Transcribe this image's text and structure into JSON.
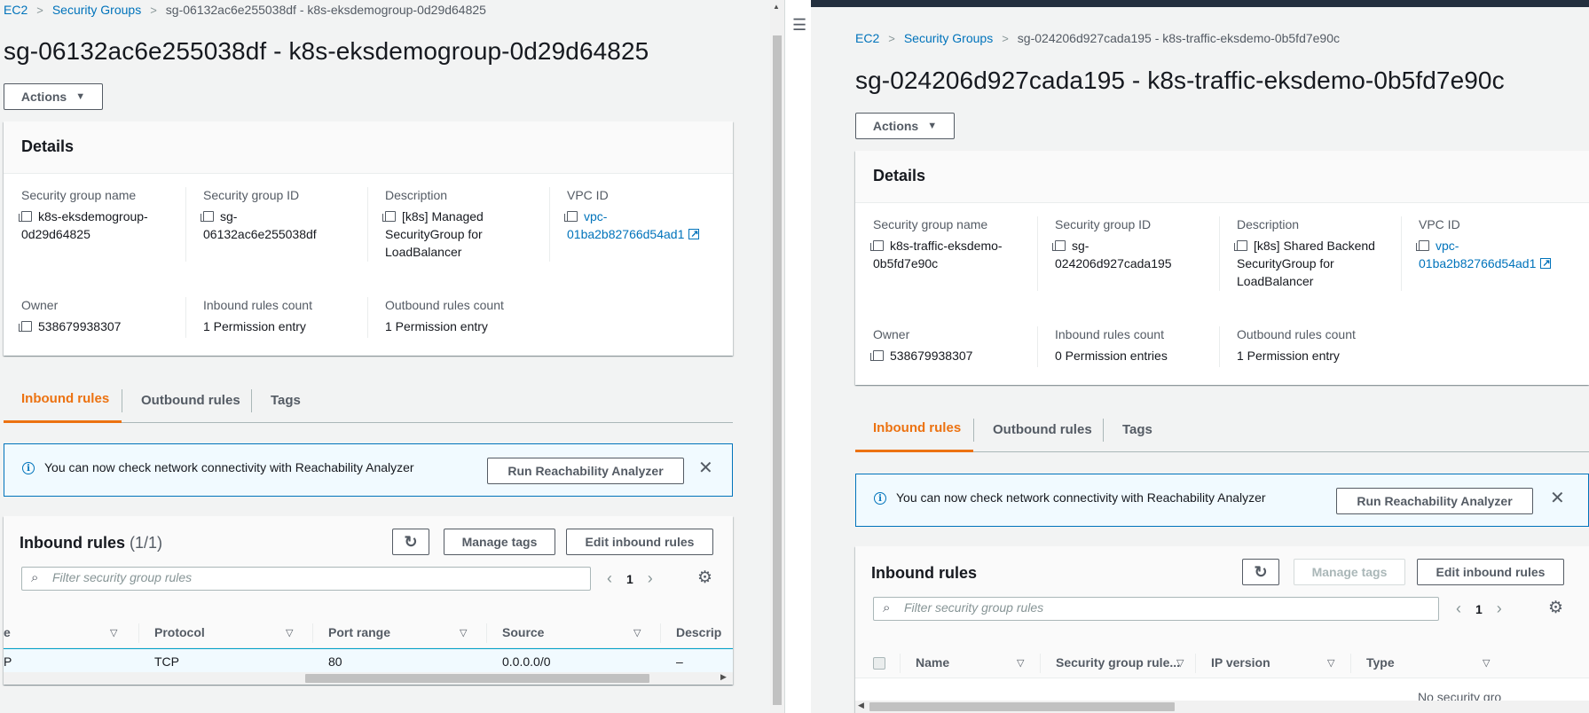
{
  "left": {
    "breadcrumb": {
      "home": "EC2",
      "section": "Security Groups",
      "current": "sg-06132ac6e255038df - k8s-eksdemogroup-0d29d64825"
    },
    "title": "sg-06132ac6e255038df - k8s-eksdemogroup-0d29d64825",
    "actions_label": "Actions",
    "details": {
      "heading": "Details",
      "sg_name_label": "Security group name",
      "sg_name_value_1": "k8s-eksdemogroup-",
      "sg_name_value_2": "0d29d64825",
      "sg_id_label": "Security group ID",
      "sg_id_value_1": "sg-",
      "sg_id_value_2": "06132ac6e255038df",
      "desc_label": "Description",
      "desc_value_1": "[k8s] Managed",
      "desc_value_2": "SecurityGroup for",
      "desc_value_3": "LoadBalancer",
      "vpc_label": "VPC ID",
      "vpc_value_1": "vpc-",
      "vpc_value_2": "01ba2b82766d54ad1",
      "owner_label": "Owner",
      "owner_value": "538679938307",
      "inbound_count_label": "Inbound rules count",
      "inbound_count_value": "1 Permission entry",
      "outbound_count_label": "Outbound rules count",
      "outbound_count_value": "1 Permission entry"
    },
    "tabs": [
      "Inbound rules",
      "Outbound rules",
      "Tags"
    ],
    "flash": {
      "message": "You can now check network connectivity with Reachability Analyzer",
      "button": "Run Reachability Analyzer"
    },
    "rules": {
      "title": "Inbound rules",
      "count": "(1/1)",
      "manage_tags": "Manage tags",
      "edit": "Edit inbound rules",
      "search_placeholder": "Filter security group rules",
      "page": "1",
      "columns": [
        "e",
        "Protocol",
        "Port range",
        "Source",
        "Descrip"
      ],
      "row": [
        "P",
        "TCP",
        "80",
        "0.0.0.0/0",
        "–"
      ]
    }
  },
  "right": {
    "breadcrumb": {
      "home": "EC2",
      "section": "Security Groups",
      "current": "sg-024206d927cada195 - k8s-traffic-eksdemo-0b5fd7e90c"
    },
    "title": "sg-024206d927cada195 - k8s-traffic-eksdemo-0b5fd7e90c",
    "actions_label": "Actions",
    "details": {
      "heading": "Details",
      "sg_name_label": "Security group name",
      "sg_name_value_1": "k8s-traffic-eksdemo-",
      "sg_name_value_2": "0b5fd7e90c",
      "sg_id_label": "Security group ID",
      "sg_id_value_1": "sg-",
      "sg_id_value_2": "024206d927cada195",
      "desc_label": "Description",
      "desc_value_1": "[k8s] Shared Backend",
      "desc_value_2": "SecurityGroup for",
      "desc_value_3": "LoadBalancer",
      "vpc_label": "VPC ID",
      "vpc_value_1": "vpc-",
      "vpc_value_2": "01ba2b82766d54ad1",
      "owner_label": "Owner",
      "owner_value": "538679938307",
      "inbound_count_label": "Inbound rules count",
      "inbound_count_value": "0 Permission entries",
      "outbound_count_label": "Outbound rules count",
      "outbound_count_value": "1 Permission entry"
    },
    "tabs": [
      "Inbound rules",
      "Outbound rules",
      "Tags"
    ],
    "flash": {
      "message": "You can now check network connectivity with Reachability Analyzer",
      "button": "Run Reachability Analyzer"
    },
    "rules": {
      "title": "Inbound rules",
      "manage_tags": "Manage tags",
      "edit": "Edit inbound rules",
      "search_placeholder": "Filter security group rules",
      "page": "1",
      "columns": [
        "Name",
        "Security group rule...",
        "IP version",
        "Type"
      ],
      "empty": "No security gro"
    }
  },
  "icons": {
    "copy": "copy-icon",
    "external": "external-link-icon",
    "info": "info-icon",
    "refresh": "refresh-icon",
    "search": "search-icon",
    "settings": "gear-icon",
    "menu": "hamburger-icon"
  },
  "colors": {
    "link": "#0073bb",
    "active_tab": "#ec7211",
    "flash_bg": "#f1faff",
    "nav": "#232f3e"
  }
}
